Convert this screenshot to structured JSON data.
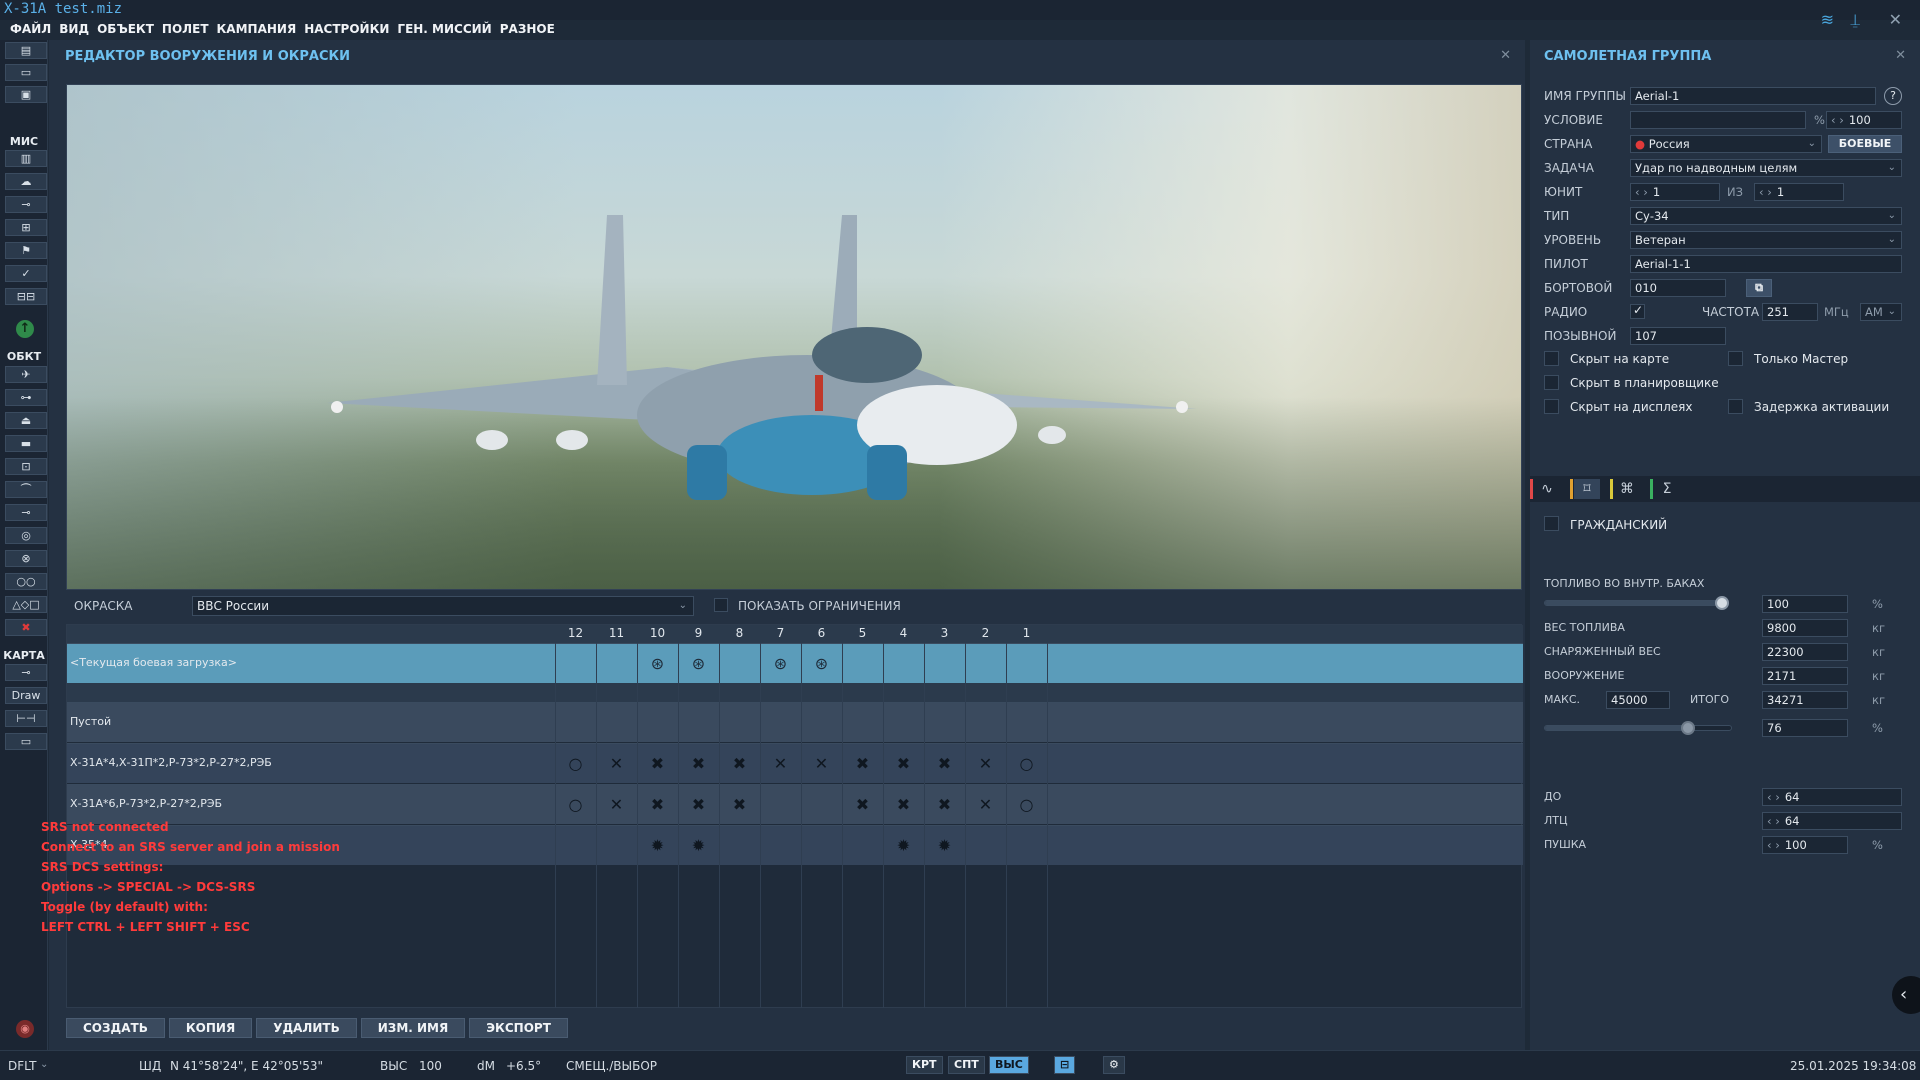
{
  "app": {
    "title": "X-31A test.miz"
  },
  "menu": [
    "ФАЙЛ",
    "ВИД",
    "ОБЪЕКТ",
    "ПОЛЕТ",
    "КАМПАНИЯ",
    "НАСТРОЙКИ",
    "ГЕН. МИССИЙ",
    "РАЗНОЕ"
  ],
  "toolbar": {
    "mission_label": "МИС",
    "objects_label": "ОБКТ",
    "map_label": "КАРТА",
    "draw_label": "Draw"
  },
  "editor": {
    "title": "РЕДАКТОР ВООРУЖЕНИЯ И ОКРАСКИ",
    "livery_label": "ОКРАСКА",
    "livery_value": "ВВС России",
    "show_limits_label": "ПОКАЗАТЬ ОГРАНИЧЕНИЯ",
    "stations": [
      "12",
      "11",
      "10",
      "9",
      "8",
      "7",
      "6",
      "5",
      "4",
      "3",
      "2",
      "1"
    ],
    "loadouts": [
      {
        "name": "<Текущая боевая загрузка>",
        "symbols": [
          "",
          "",
          "⊛",
          "⊛",
          "",
          "⊛",
          "⊛",
          "",
          "",
          "",
          "",
          ""
        ]
      },
      {
        "name": "Пустой",
        "symbols": [
          "",
          "",
          "",
          "",
          "",
          "",
          "",
          "",
          "",
          "",
          "",
          ""
        ]
      },
      {
        "name": "Х-31А*4,Х-31П*2,Р-73*2,Р-27*2,РЭБ",
        "symbols": [
          "○",
          "✕",
          "✖",
          "✖",
          "✖",
          "✕",
          "✕",
          "✖",
          "✖",
          "✖",
          "✕",
          "○"
        ]
      },
      {
        "name": "Х-31А*6,Р-73*2,Р-27*2,РЭБ",
        "symbols": [
          "○",
          "✕",
          "✖",
          "✖",
          "✖",
          "",
          "",
          "✖",
          "✖",
          "✖",
          "✕",
          "○"
        ]
      },
      {
        "name": "X-35*4",
        "symbols": [
          "",
          "",
          "✹",
          "✹",
          "",
          "",
          "",
          "",
          "✹",
          "✹",
          "",
          ""
        ]
      }
    ],
    "buttons": {
      "create": "СОЗДАТЬ",
      "copy": "КОПИЯ",
      "delete": "УДАЛИТЬ",
      "rename": "ИЗМ. ИМЯ",
      "export": "ЭКСПОРТ"
    }
  },
  "srs": [
    "SRS not connected",
    "Connect to an SRS server and join a mission",
    "SRS DCS settings:",
    "Options -> SPECIAL -> DCS-SRS",
    "Toggle (by default) with:",
    "LEFT CTRL + LEFT SHIFT + ESC"
  ],
  "group": {
    "title": "САМОЛЕТНАЯ ГРУППА",
    "name_label": "ИМЯ ГРУППЫ",
    "name_value": "Aerial-1",
    "condition_label": "УСЛОВИЕ",
    "condition_value": "",
    "percent_unit": "%",
    "condition_percent": "100",
    "country_label": "СТРАНА",
    "country_value": "Россия",
    "combat_button": "БОЕВЫЕ",
    "task_label": "ЗАДАЧА",
    "task_value": "Удар по надводным целям",
    "unit_label": "ЮНИТ",
    "unit_value": "1",
    "of_label": "ИЗ",
    "of_value": "1",
    "type_label": "ТИП",
    "type_value": "Су-34",
    "skill_label": "УРОВЕНЬ",
    "skill_value": "Ветеран",
    "pilot_label": "ПИЛОТ",
    "pilot_value": "Aerial-1-1",
    "board_label": "БОРТОВОЙ",
    "board_value": "010",
    "radio_label": "РАДИО",
    "freq_label": "ЧАСТОТА",
    "freq_value": "251",
    "freq_unit": "МГц",
    "modulation": "AM",
    "callsign_label": "ПОЗЫВНОЙ",
    "callsign_value": "107",
    "checkboxes": {
      "hidden_map": "Скрыт на карте",
      "master_only": "Только Мастер",
      "hidden_planner": "Скрыт в планировщике",
      "hidden_display": "Скрыт на дисплеях",
      "late_activation": "Задержка активации"
    },
    "civil_label": "ГРАЖДАНСКИЙ",
    "fuel_label": "ТОПЛИВО ВО ВНУТР. БАКАХ",
    "fuel_percent": "100",
    "fuel_level": 1.0,
    "fuel_weight_label": "ВЕС ТОПЛИВА",
    "fuel_weight": "9800",
    "empty_weight_label": "СНАРЯЖЕННЫЙ ВЕС",
    "empty_weight": "22300",
    "weapons_label": "ВООРУЖЕНИЕ",
    "weapons_weight": "2171",
    "max_label": "МАКС.",
    "max_value": "45000",
    "total_label": "ИТОГО",
    "total_value": "34271",
    "kg_unit": "кг",
    "load_percent": "76",
    "load_level": 0.76,
    "chaff_label": "ДО",
    "chaff_value": "64",
    "flare_label": "ЛТЦ",
    "flare_value": "64",
    "gun_label": "ПУШКА",
    "gun_value": "100"
  },
  "status": {
    "profile": "DFLT",
    "coord_label": "ШД",
    "coords": "N 41°58'24\", E 42°05'53\"",
    "alt_label": "ВЫС",
    "alt_value": "100",
    "dm_label": "dM",
    "dm_value": "+6.5°",
    "mode": "СМЕЩ./ВЫБОР",
    "krt": "КРТ",
    "spt": "СПТ",
    "vys": "ВЫС",
    "datetime": "25.01.2025 19:34:08"
  },
  "colors": {
    "accent": "#6ec1f0",
    "current_row": "#5b9cba",
    "srs_text": "#ff3b3b"
  }
}
